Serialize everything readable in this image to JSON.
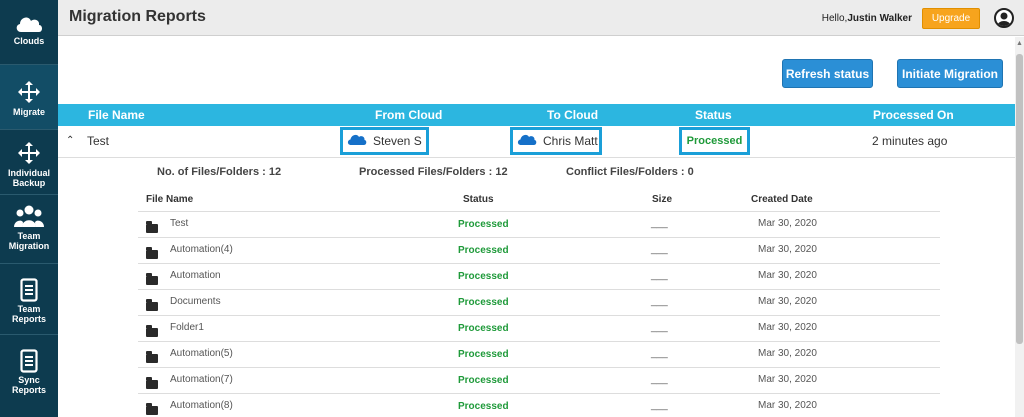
{
  "sidebar": {
    "items": [
      {
        "label": "Clouds",
        "icon": "cloud-icon"
      },
      {
        "label": "Migrate",
        "icon": "move-arrows-icon"
      },
      {
        "label": "Individual Backup",
        "icon": "move-arrows-icon"
      },
      {
        "label": "Team Migration",
        "icon": "team-icon"
      },
      {
        "label": "Team Reports",
        "icon": "report-icon"
      },
      {
        "label": "Sync Reports",
        "icon": "report-icon"
      }
    ]
  },
  "header": {
    "title": "Migration Reports",
    "greeting_prefix": "Hello,",
    "user_name": "Justin Walker",
    "upgrade_label": "Upgrade"
  },
  "actions": {
    "refresh_label": "Refresh status",
    "initiate_label": "Initiate Migration"
  },
  "table": {
    "headers": [
      "File Name",
      "From Cloud",
      "To Cloud",
      "Status",
      "Processed On"
    ],
    "row": {
      "name": "Test",
      "from_cloud": "Steven S",
      "to_cloud": "Chris Matt",
      "status": "Processed",
      "processed_on": "2 minutes ago"
    }
  },
  "summary": {
    "files": "No. of Files/Folders : 12",
    "processed": "Processed Files/Folders : 12",
    "conflict": "Conflict Files/Folders : 0"
  },
  "files": {
    "headers": [
      "File Name",
      "Status",
      "Size",
      "Created Date"
    ],
    "rows": [
      {
        "name": "Test",
        "status": "Processed",
        "size": "___",
        "date": "Mar 30, 2020"
      },
      {
        "name": "Automation(4)",
        "status": "Processed",
        "size": "___",
        "date": "Mar 30, 2020"
      },
      {
        "name": "Automation",
        "status": "Processed",
        "size": "___",
        "date": "Mar 30, 2020"
      },
      {
        "name": "Documents",
        "status": "Processed",
        "size": "___",
        "date": "Mar 30, 2020"
      },
      {
        "name": "Folder1",
        "status": "Processed",
        "size": "___",
        "date": "Mar 30, 2020"
      },
      {
        "name": "Automation(5)",
        "status": "Processed",
        "size": "___",
        "date": "Mar 30, 2020"
      },
      {
        "name": "Automation(7)",
        "status": "Processed",
        "size": "___",
        "date": "Mar 30, 2020"
      },
      {
        "name": "Automation(8)",
        "status": "Processed",
        "size": "___",
        "date": "Mar 30, 2020"
      }
    ]
  },
  "colors": {
    "sidebar": "#0d3b4f",
    "accent": "#2cb6e0",
    "button": "#2b8fd6",
    "upgrade": "#f7a41d",
    "processed": "#1f9a3a"
  }
}
